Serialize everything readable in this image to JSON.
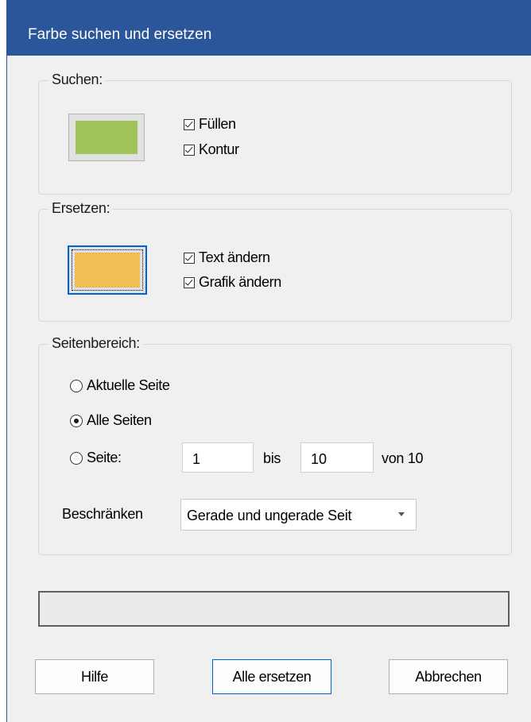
{
  "window": {
    "title": "Farbe suchen und ersetzen"
  },
  "colors": {
    "accent": "#2b579a",
    "search_color": "#a1c45a",
    "replace_color": "#f0bd56"
  },
  "search": {
    "legend": "Suchen:",
    "swatch": "search-color-swatch",
    "options": [
      {
        "label": "Füllen",
        "checked": true
      },
      {
        "label": "Kontur",
        "checked": true
      }
    ]
  },
  "replace": {
    "legend": "Ersetzen:",
    "swatch": "replace-color-swatch",
    "options": [
      {
        "label": "Text ändern",
        "checked": true
      },
      {
        "label": "Grafik ändern",
        "checked": true
      }
    ]
  },
  "page_range": {
    "legend": "Seitenbereich:",
    "radios": [
      {
        "label": "Aktuelle Seite",
        "selected": false
      },
      {
        "label": "Alle Seiten",
        "selected": true
      },
      {
        "label": "Seite:",
        "selected": false
      }
    ],
    "from_value": "1",
    "to_label": "bis",
    "to_value": "10",
    "of_label": "von 10",
    "restrict_label": "Beschränken",
    "restrict_value": "Gerade und ungerade Seit"
  },
  "progress": {
    "fraction": 0
  },
  "buttons": {
    "help": "Hilfe",
    "replace_all": "Alle ersetzen",
    "cancel": "Abbrechen"
  }
}
